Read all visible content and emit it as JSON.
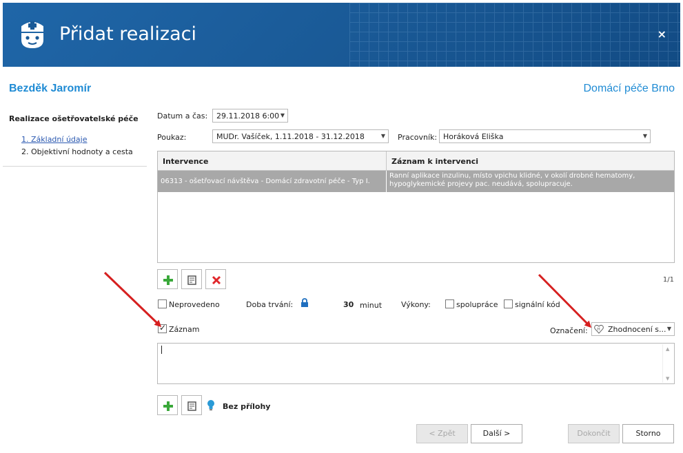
{
  "window": {
    "title": "Přidat realizaci",
    "close_label": "×"
  },
  "header": {
    "patient_name": "Bezděk Jaromír",
    "organization": "Domácí péče Brno"
  },
  "nav": {
    "title": "Realizace ošetřovatelské péče",
    "items": [
      {
        "label": "1. Základní údaje"
      },
      {
        "label": "2. Objektivní hodnoty a cesta"
      }
    ]
  },
  "form": {
    "datetime_label": "Datum a čas:",
    "datetime_value": "29.11.2018 6:00",
    "voucher_label": "Poukaz:",
    "voucher_value": "MUDr. Vašíček, 1.11.2018 - 31.12.2018",
    "worker_label": "Pracovník:",
    "worker_value": "Horáková Eliška"
  },
  "grid": {
    "columns": [
      "Intervence",
      "Záznam k intervenci"
    ],
    "rows": [
      {
        "intervention": "06313 - ošetřovací návštěva - Domácí zdravotní péče - Typ I.",
        "record_line1": "Ranní aplikace  inzulinu,  místo vpichu klidné, v okolí drobné hematomy,",
        "record_line2": "hypoglykemické projevy pac. neudává, spolupracuje."
      }
    ],
    "pager": "1/1"
  },
  "options": {
    "not_done_label": "Neprovedeno",
    "duration_label": "Doba trvání:",
    "duration_value": "30",
    "duration_unit": "minut",
    "procedures_label": "Výkony:",
    "cooperation_label": "spolupráce",
    "signal_code_label": "signální kód",
    "record_label": "Záznam",
    "marking_label": "Označení:",
    "marking_value": "Zhodnocení s..."
  },
  "attachments": {
    "label": "Bez přílohy"
  },
  "buttons": {
    "back": "< Zpět",
    "next": "Další >",
    "finish": "Dokončit",
    "cancel": "Storno"
  },
  "colors": {
    "title_bar": "#1a5a97",
    "accent_text": "#1f8bd4",
    "add_green": "#3aa83a",
    "delete_red": "#e0262a",
    "annotation_arrow": "#d62020"
  }
}
